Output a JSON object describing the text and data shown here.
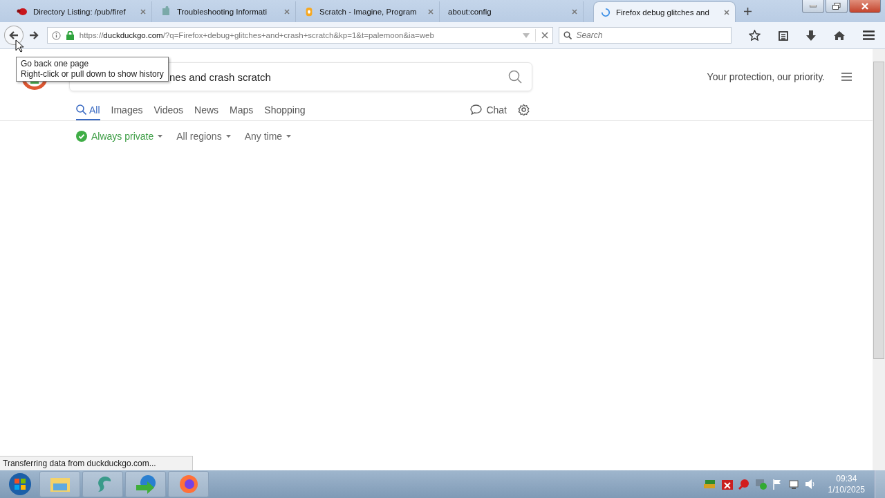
{
  "tabs": [
    {
      "title": "Directory Listing: /pub/firef",
      "selected": false,
      "loading": false
    },
    {
      "title": "Troubleshooting Informati",
      "selected": false,
      "loading": false
    },
    {
      "title": "Scratch - Imagine, Program",
      "selected": false,
      "loading": false
    },
    {
      "title": "about:config",
      "selected": false,
      "loading": false
    },
    {
      "title": "Firefox debug glitches and",
      "selected": true,
      "loading": true
    }
  ],
  "toolbar": {
    "url_domain": "duckduckgo.com",
    "url_prefix": "https://",
    "url_rest": "/?q=Firefox+debug+glitches+and+crash+scratch&kp=1&t=palemoon&ia=web",
    "search_placeholder": "Search"
  },
  "tooltip": {
    "lines": [
      "Go back one page",
      "Right-click or pull down to show history"
    ]
  },
  "page": {
    "query": "nes and crash scratch",
    "tagline": "Your protection, our priority.",
    "nav": [
      {
        "label": "All",
        "selected": true
      },
      {
        "label": "Images",
        "selected": false
      },
      {
        "label": "Videos",
        "selected": false
      },
      {
        "label": "News",
        "selected": false
      },
      {
        "label": "Maps",
        "selected": false
      },
      {
        "label": "Shopping",
        "selected": false
      }
    ],
    "chat": "Chat",
    "filters": [
      {
        "label": "Always private",
        "kind": "privacy"
      },
      {
        "label": "All regions",
        "kind": "plain"
      },
      {
        "label": "Any time",
        "kind": "plain"
      }
    ]
  },
  "status_bar": "Transferring data from duckduckgo.com...",
  "taskbar": {
    "time": "09:34",
    "date": "1/10/2025"
  }
}
